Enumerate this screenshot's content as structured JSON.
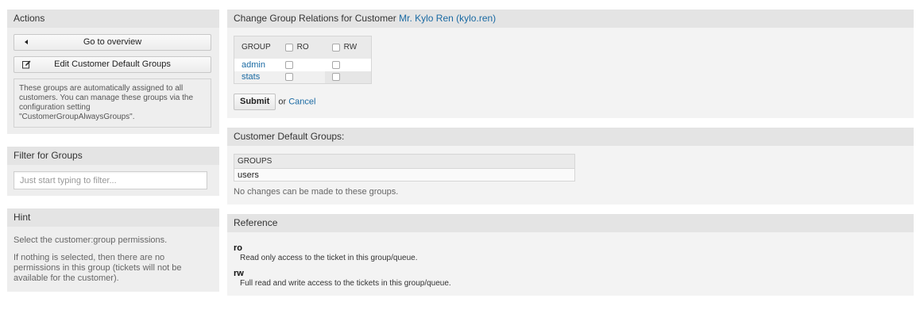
{
  "sidebar": {
    "actions": {
      "title": "Actions",
      "go_overview": "Go to overview",
      "edit_defaults": "Edit Customer Default Groups",
      "note": "These groups are automatically assigned to all customers. You can manage these groups via the configuration setting \"CustomerGroupAlwaysGroups\"."
    },
    "filter": {
      "title": "Filter for Groups",
      "placeholder": "Just start typing to filter..."
    },
    "hint": {
      "title": "Hint",
      "p1": "Select the customer:group permissions.",
      "p2": "If nothing is selected, then there are no permissions in this group (tickets will not be available for the customer)."
    }
  },
  "relations": {
    "title_prefix": "Change Group Relations for Customer",
    "customer_link": "Mr. Kylo Ren (kylo.ren)",
    "columns": [
      "GROUP",
      "RO",
      "RW"
    ],
    "rows": [
      {
        "group": "admin",
        "ro": false,
        "rw": false
      },
      {
        "group": "stats",
        "ro": false,
        "rw": false
      }
    ],
    "submit": "Submit",
    "or": "or",
    "cancel": "Cancel"
  },
  "defaults": {
    "title": "Customer Default Groups:",
    "column": "GROUPS",
    "rows": [
      "users"
    ],
    "note": "No changes can be made to these groups."
  },
  "reference": {
    "title": "Reference",
    "ro_term": "ro",
    "ro_desc": "Read only access to the ticket in this group/queue.",
    "rw_term": "rw",
    "rw_desc": "Full read and write access to the tickets in this group/queue."
  },
  "colors": {
    "link": "#1a6aa3",
    "header_bg": "#e4e4e4",
    "panel_bg": "#eeeeee"
  }
}
